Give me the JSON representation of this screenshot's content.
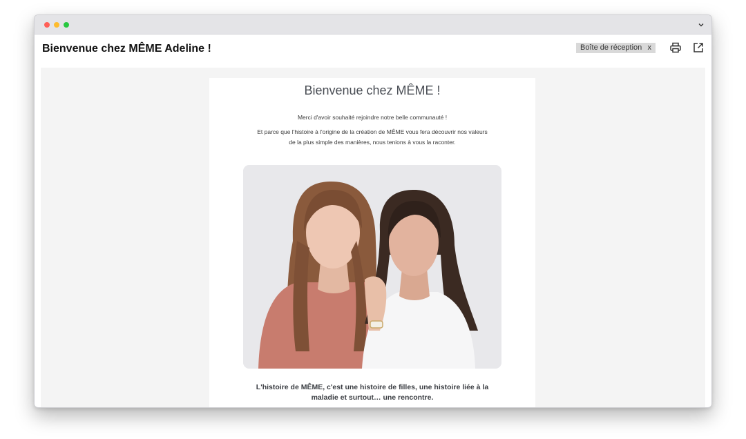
{
  "window": {
    "subject": "Bienvenue chez MÊME Adeline !",
    "folder_tag": "Boîte de réception",
    "folder_tag_close": "x"
  },
  "email": {
    "title": "Bienvenue chez MÊME !",
    "intro_line1": "Merci d'avoir souhaité rejoindre notre belle communauté !",
    "intro_line2": "Et parce que l'histoire à l'origine de la création de MÊME vous fera découvrir nos valeurs",
    "intro_line3": "de la plus simple des manières, nous tenions à vous la raconter.",
    "story_line1": "L'histoire de MÊME, c'est une histoire de filles, une histoire liée à la",
    "story_line2": "maladie et surtout… une rencontre."
  },
  "icons": {
    "window_controls": [
      "close-dot",
      "minimize-dot",
      "maximize-dot"
    ],
    "toolbar": [
      "print-icon",
      "open-external-icon"
    ]
  },
  "colors": {
    "traffic_red": "#ff5f57",
    "traffic_yellow": "#febc2e",
    "traffic_green": "#28c840",
    "heading_text": "#4a4e55"
  }
}
